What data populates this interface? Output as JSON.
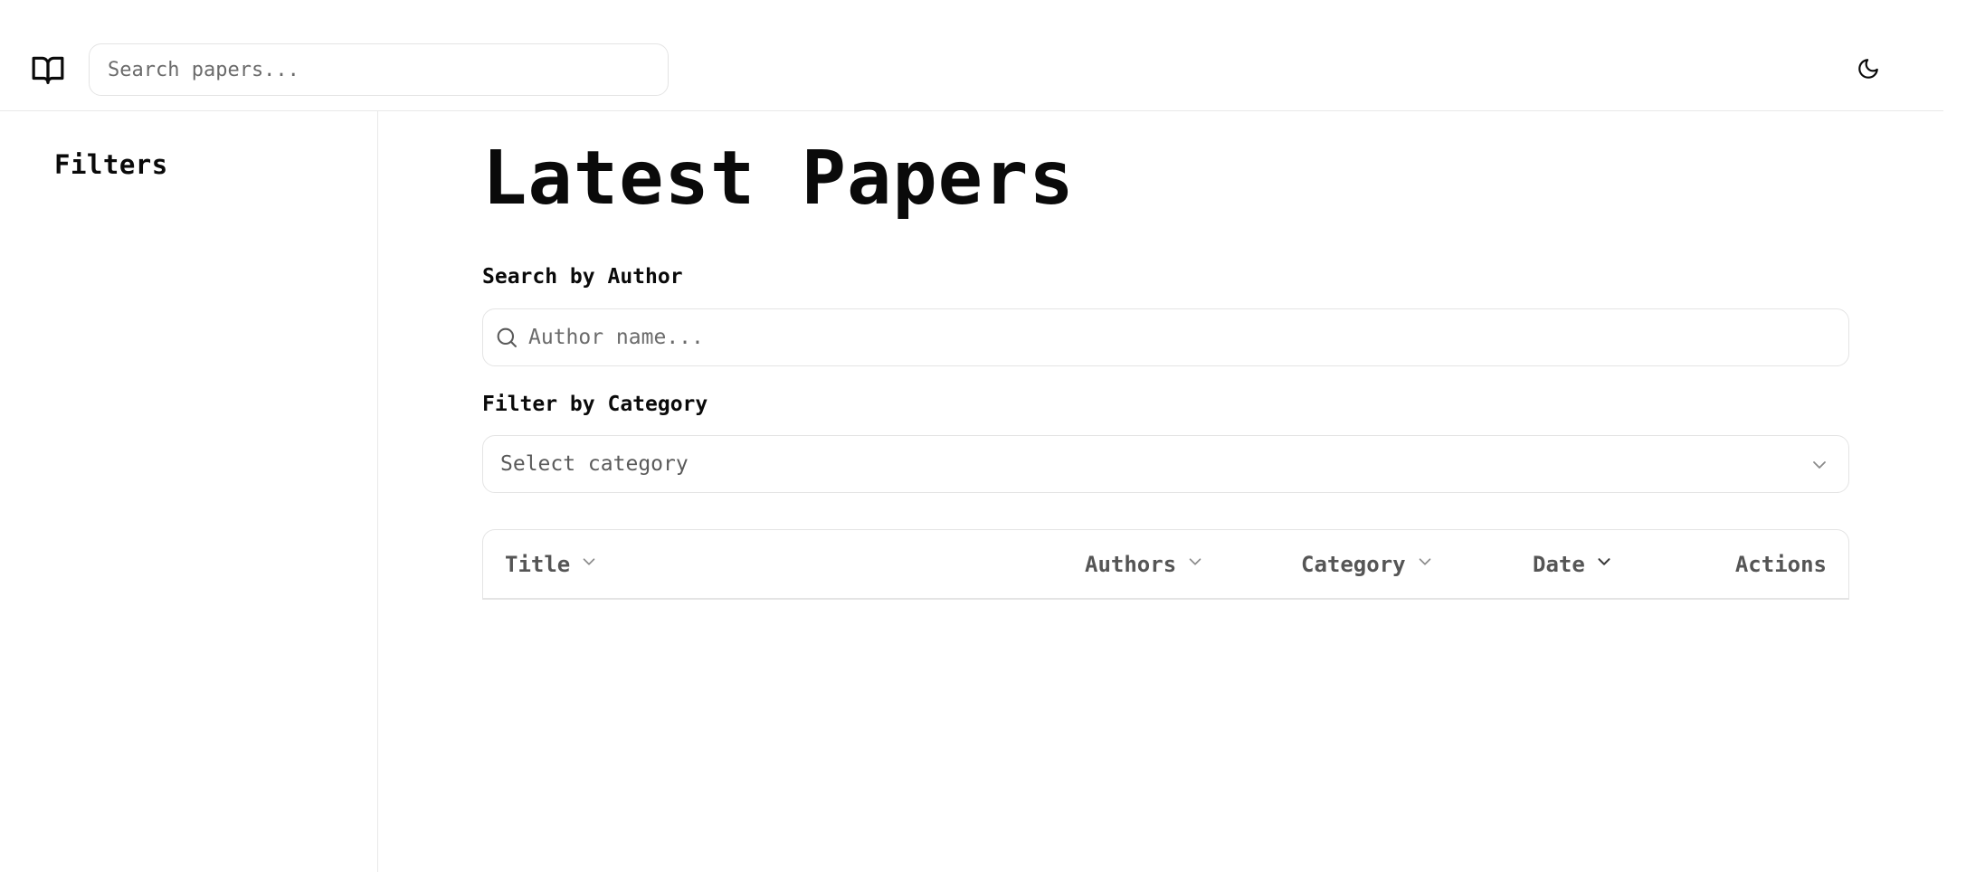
{
  "header": {
    "search_placeholder": "Search papers..."
  },
  "sidebar": {
    "title": "Filters"
  },
  "main": {
    "title": "Latest Papers",
    "author_filter": {
      "label": "Search by Author",
      "placeholder": "Author name..."
    },
    "category_filter": {
      "label": "Filter by Category",
      "placeholder": "Select category"
    },
    "table": {
      "columns": [
        "Title",
        "Authors",
        "Category",
        "Date",
        "Actions"
      ]
    }
  },
  "icons": {
    "logo": "book-open-icon",
    "theme_toggle": "moon-icon",
    "author_search": "search-icon",
    "select": "chevron-down-icon",
    "sort": "chevron-down-icon"
  }
}
